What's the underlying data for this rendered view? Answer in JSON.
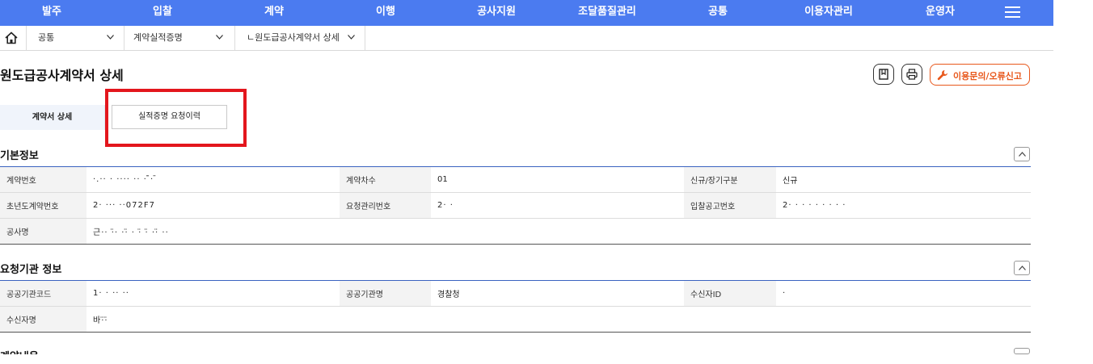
{
  "topnav": {
    "items": [
      "발주",
      "입찰",
      "계약",
      "이행",
      "공사지원",
      "조달품질관리",
      "공통",
      "이용자관리",
      "운영자"
    ],
    "menu_icon": "hamburger-icon"
  },
  "breadcrumb": {
    "home_icon": "home-icon",
    "items": [
      "공통",
      "계약실적증명",
      "ㄴ원도급공사계약서 상세"
    ]
  },
  "page": {
    "title": "원도급공사계약서 상세",
    "report_label": "이용문의/오류신고",
    "accent_color": "#4b7bf0",
    "report_color": "#e8581c"
  },
  "tabs": [
    "계약서 상세",
    "실적증명 요청이력"
  ],
  "sections": {
    "basic": {
      "title": "기본정보",
      "rows": [
        [
          {
            "label": "계약번호",
            "value": "·.··  ·  ···· ·· ·  ̄̄·  ̄"
          },
          {
            "label": "계약차수",
            "value": "01"
          },
          {
            "label": "신규/장기구분",
            "value": "신규"
          }
        ],
        [
          {
            "label": "초년도계약번호",
            "value": "2·  ··· ··072F7"
          },
          {
            "label": "요청관리번호",
            "value": "2·  ·"
          },
          {
            "label": "입찰공고번호",
            "value": "2· · ·  · · ·  ·  ·  ·"
          }
        ],
        [
          {
            "label": "공사명",
            "value": "근··  ·̈· ··̈ ·  ·̈  ·̈ ··̈ ··"
          }
        ]
      ]
    },
    "agency": {
      "title": "요청기관 정보",
      "rows": [
        [
          {
            "label": "공공기관코드",
            "value": "1·   · ·· ··"
          },
          {
            "label": "공공기관명",
            "value": "경찰청"
          },
          {
            "label": "수신자ID",
            "value": "·"
          }
        ],
        [
          {
            "label": "수신자명",
            "value": "바·̈·̈"
          }
        ]
      ]
    },
    "contract": {
      "title": "계약내용"
    }
  }
}
